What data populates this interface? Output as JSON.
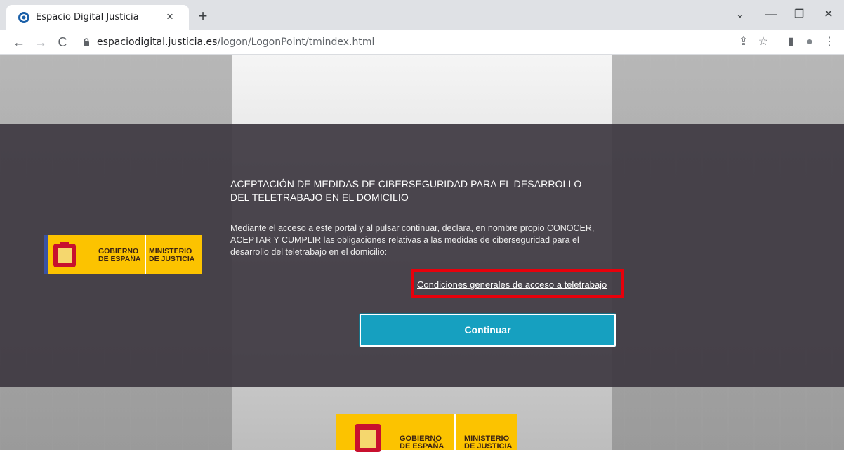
{
  "browser": {
    "tab_title": "Espacio Digital Justicia",
    "tab_close": "×",
    "new_tab": "+",
    "url_host": "espaciodigital.justicia.es",
    "url_path": "/logon/LogonPoint/tmindex.html",
    "window_controls": {
      "collapse": "⌄",
      "minimize": "—",
      "restore": "❐",
      "close": "✕"
    },
    "nav": {
      "back": "←",
      "forward": "→",
      "reload": "C"
    },
    "toolbar_icons": {
      "share": "⇪",
      "bookmark": "☆",
      "sidepanel": "▮",
      "profile": "●",
      "menu": "⋮"
    }
  },
  "logo": {
    "gobierno": [
      "GOBIERNO",
      "DE ESPAÑA"
    ],
    "ministerio": [
      "MINISTERIO",
      "DE JUSTICIA"
    ]
  },
  "main": {
    "heading": "ACEPTACIÓN DE MEDIDAS DE CIBERSEGURIDAD PARA EL DESARROLLO DEL TELETRABAJO EN EL DOMICILIO",
    "description": "Mediante el acceso a este portal y al pulsar continuar, declara, en nombre propio CONOCER, ACEPTAR Y CUMPLIR las obligaciones relativas a las medidas de ciberseguridad para el desarrollo del teletrabajo en el domicilio:",
    "terms_link": "Condiciones generales de acceso a teletrabajo",
    "continue_button": "Continuar"
  },
  "colors": {
    "band": "#3e3942",
    "logo_yellow": "#fcc300",
    "button_teal": "#16a0c0",
    "highlight_red": "#e8000b"
  }
}
